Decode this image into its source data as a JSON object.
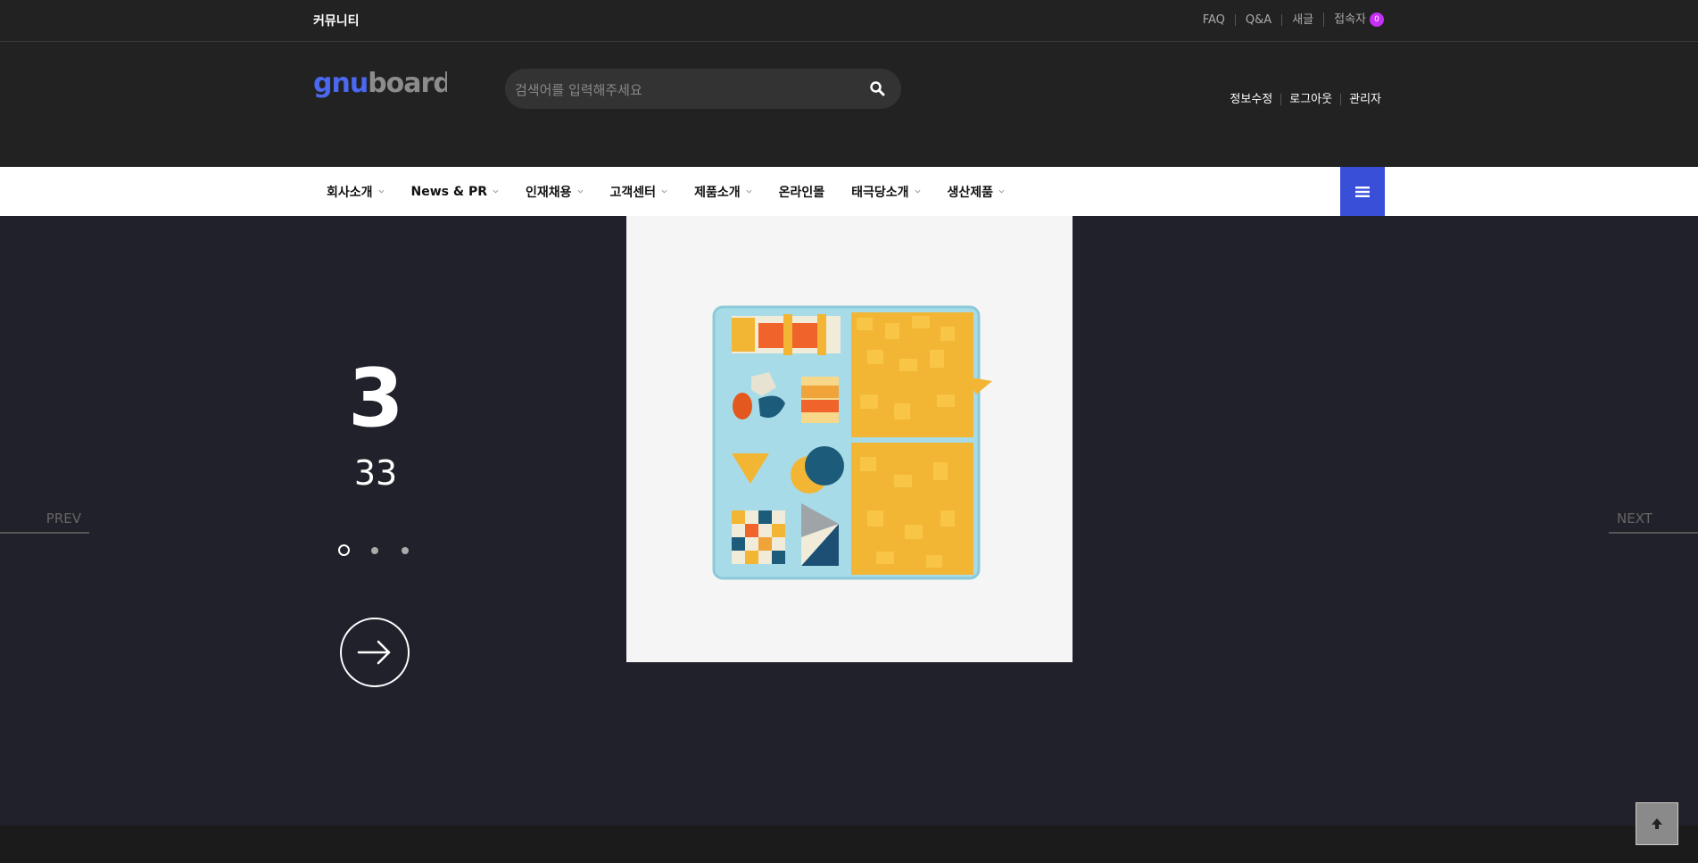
{
  "topbar": {
    "community": "커뮤니티",
    "links": [
      "FAQ",
      "Q&A",
      "새글",
      "접속자"
    ],
    "visitor_count": "0"
  },
  "header": {
    "logo": "gnuboard",
    "search_placeholder": "검색어를 입력해주세요",
    "links": [
      "정보수정",
      "로그아웃",
      "관리자"
    ]
  },
  "nav": {
    "items": [
      "회사소개",
      "News & PR",
      "인재채용",
      "고객센터",
      "제품소개",
      "온라인몰",
      "태극당소개",
      "생산제품"
    ]
  },
  "hero": {
    "number": "3",
    "subtitle": "33",
    "prev": "PREV",
    "next": "NEXT",
    "slides": 3,
    "active_slide": 1
  },
  "colors": {
    "accent": "#3a4fd8",
    "badge": "#c72ef7",
    "header_bg": "#222222",
    "hero_bg": "#21212b"
  }
}
